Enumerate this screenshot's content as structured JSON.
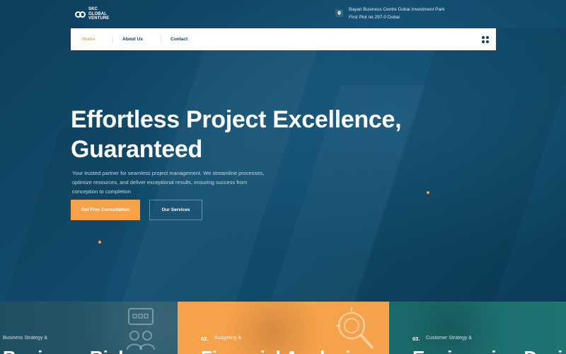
{
  "brand": {
    "logo_line1": "SKC",
    "logo_line2": "GLOBAL",
    "logo_line3": "VENTURE"
  },
  "contact": {
    "address_line1": "Bayan Business Centre Dubai Investment Park",
    "address_line2": "First Plot no 297-0 Dubai"
  },
  "nav": {
    "items": [
      {
        "label": "Home",
        "active": true
      },
      {
        "label": "About Us",
        "active": false
      },
      {
        "label": "Contact",
        "active": false
      }
    ]
  },
  "hero": {
    "title_line1": "Effortless Project Excellence,",
    "title_line2": "Guaranteed",
    "subtitle_line1": "Your trusted partner for seamless project management. We streamline processes,",
    "subtitle_line2": "optimize resources, and deliver exceptional results, ensuring success from",
    "subtitle_line3": "conception to completion",
    "primary_cta": "Get Free Consultation",
    "secondary_cta": "Our Services"
  },
  "cards": [
    {
      "number": "",
      "category": "Business Strategy &",
      "title": "Business Risk"
    },
    {
      "number": "02.",
      "category": "Budgeting &",
      "title": "Financial Analysis"
    },
    {
      "number": "03.",
      "category": "Customer Strategy &",
      "title": "Engineering Design"
    }
  ],
  "colors": {
    "accent": "#f6a24b",
    "hero_bg": "#0f4766",
    "nav_text": "#123b57"
  },
  "icons": [
    "location-pin-icon",
    "grid-menu-icon",
    "chat-bubble-icon",
    "analytics-search-icon"
  ]
}
